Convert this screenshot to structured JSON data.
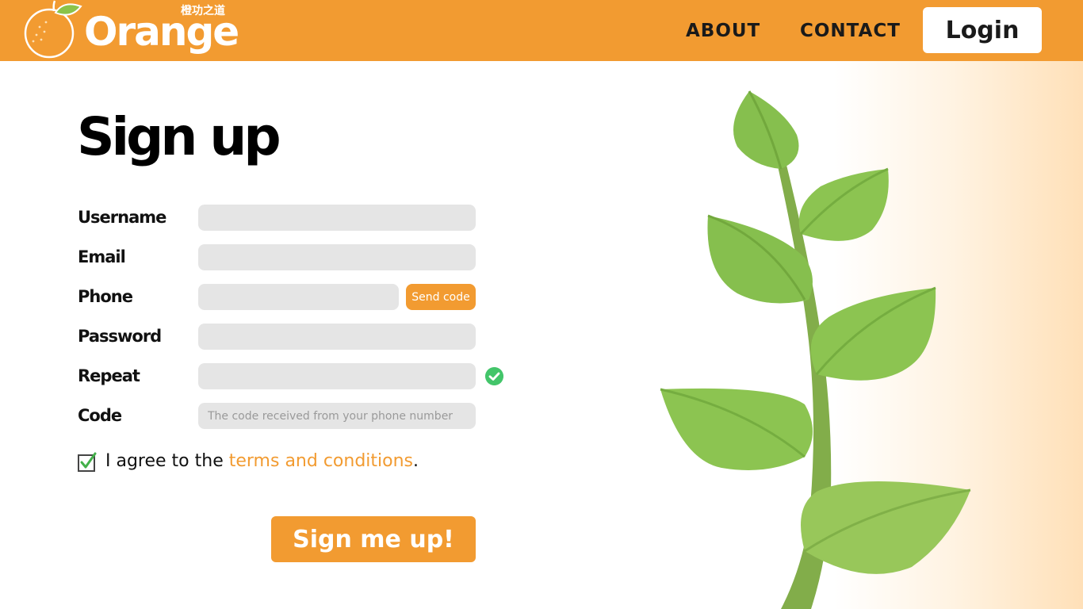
{
  "header": {
    "logo_text": "Orange",
    "logo_subtitle": "橙功之道",
    "nav": {
      "about": "ABOUT",
      "contact": "CONTACT"
    },
    "login_label": "Login"
  },
  "main": {
    "title": "Sign up",
    "fields": {
      "username": {
        "label": "Username",
        "value": "",
        "placeholder": ""
      },
      "email": {
        "label": "Email",
        "value": "",
        "placeholder": ""
      },
      "phone": {
        "label": "Phone",
        "value": "",
        "placeholder": "",
        "send_code_label": "Send code"
      },
      "password": {
        "label": "Password",
        "value": "",
        "placeholder": ""
      },
      "repeat": {
        "label": "Repeat",
        "value": "",
        "placeholder": ""
      },
      "code": {
        "label": "Code",
        "value": "",
        "placeholder": "The code received from your phone number"
      }
    },
    "agree": {
      "checked": true,
      "prefix": "I agree to the ",
      "link": "terms and conditions",
      "suffix": "."
    },
    "submit_label": "Sign me up!"
  },
  "icons": {
    "logo": "orange-fruit-icon",
    "repeat_valid": "check-circle-icon",
    "agree": "checkbox-checked-icon",
    "illustration": "plant-leaves-icon"
  },
  "colors": {
    "accent": "#f29b31",
    "input_bg": "#e5e5e5",
    "success": "#43c56a",
    "leaf": "#8bc34a"
  }
}
